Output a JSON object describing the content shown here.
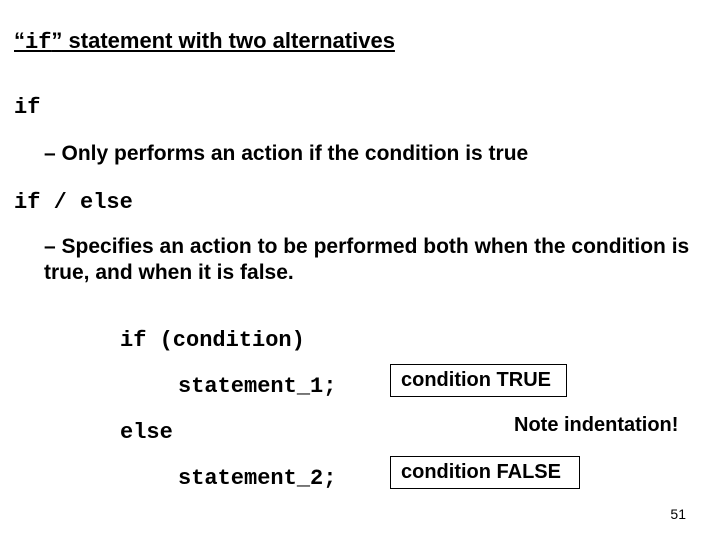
{
  "title": {
    "open_quote": "“",
    "if_word": "if",
    "close_quote_rest": "” statement with two alternatives"
  },
  "code_if": "if",
  "body1": "– Only performs an action if the condition is true",
  "code_ifelse": "if / else",
  "body2": "– Specifies an action to be performed both when the condition is true, and when it is false.",
  "snippet": {
    "l1": "if (condition)",
    "l2": "statement_1;",
    "l3": "else",
    "l4": "statement_2;"
  },
  "box_true": "condition TRUE",
  "box_false": "condition FALSE",
  "note": "Note indentation!",
  "page_number": "51"
}
